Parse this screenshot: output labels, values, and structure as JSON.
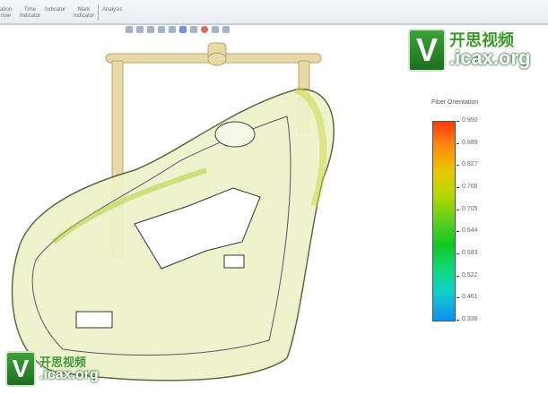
{
  "ribbon": {
    "items": [
      "ation\nriver",
      "Time\nIndicator",
      "Indicator",
      "Mark\nIndicator",
      "Analysis"
    ]
  },
  "legend": {
    "title": "Fiber Orientation",
    "ticks": [
      "0.950",
      "0.889",
      "0.827",
      "0.766",
      "0.705",
      "0.644",
      "0.583",
      "0.522",
      "0.461",
      "0.338"
    ],
    "max_color": "#ff3b0a",
    "min_color": "#1090f0"
  },
  "watermark": {
    "letter": "V",
    "cn": "开思视频",
    "en": ".icax.org"
  }
}
